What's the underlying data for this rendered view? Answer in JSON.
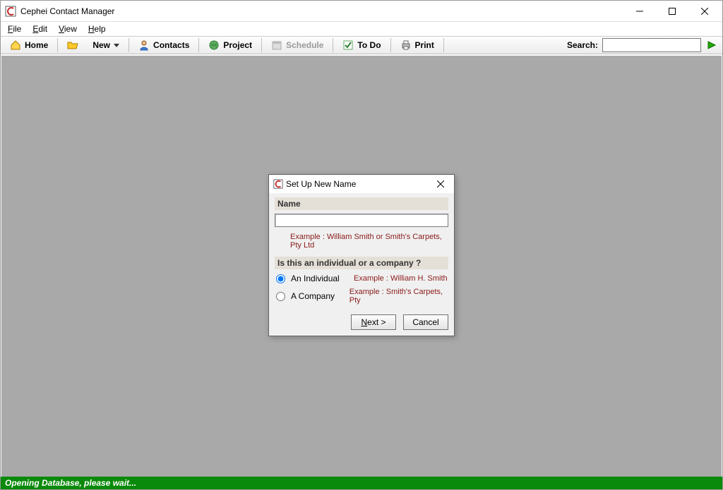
{
  "window": {
    "title": "Cephei Contact Manager"
  },
  "menubar": {
    "file": "File",
    "edit": "Edit",
    "view": "View",
    "help": "Help"
  },
  "toolbar": {
    "home": "Home",
    "new": "New",
    "contacts": "Contacts",
    "project": "Project",
    "schedule": "Schedule",
    "todo": "To Do",
    "print": "Print",
    "search_label": "Search:"
  },
  "dialog": {
    "title": "Set Up New Name",
    "name_heading": "Name",
    "name_value": "",
    "example_main": "Example : William Smith or Smith's Carpets, Pty Ltd",
    "type_heading": "Is this an individual or a company ?",
    "individual_label": "An Individual",
    "individual_example": "Example : William H. Smith",
    "company_label": "A Company",
    "company_example": "Example : Smith's Carpets, Pty",
    "selected": "individual",
    "next_label": "Next >",
    "cancel_label": "Cancel"
  },
  "status": {
    "text": "Opening Database, please wait..."
  }
}
